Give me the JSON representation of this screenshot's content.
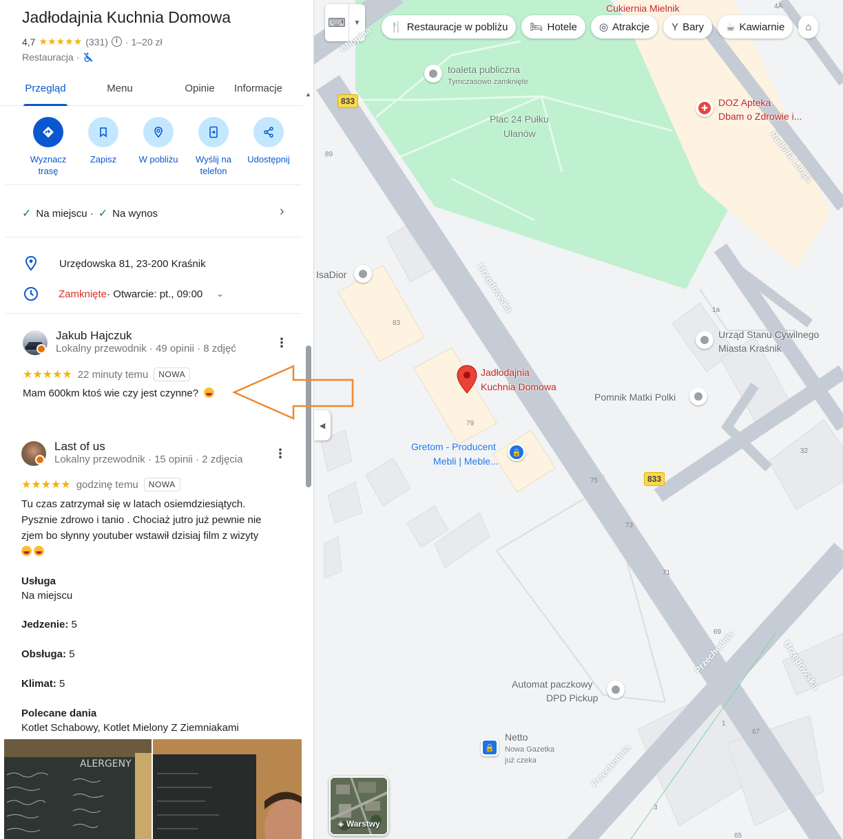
{
  "place": {
    "title": "Jadłodajnia Kuchnia Domowa",
    "rating": "4,7",
    "stars": "★★★★★",
    "review_count": "(331)",
    "price": "· 1–20 zł",
    "category": "Restauracja ·"
  },
  "tabs": [
    {
      "label": "Przegląd"
    },
    {
      "label": "Menu"
    },
    {
      "label": "Opinie"
    },
    {
      "label": "Informacje"
    }
  ],
  "actions": [
    {
      "label": "Wyznacz trasę",
      "icon": "directions-icon"
    },
    {
      "label": "Zapisz",
      "icon": "bookmark-icon"
    },
    {
      "label": "W pobliżu",
      "icon": "nearby-icon"
    },
    {
      "label": "Wyślij na telefon",
      "icon": "send-to-phone-icon"
    },
    {
      "label": "Udostępnij",
      "icon": "share-icon"
    }
  ],
  "service_options": {
    "dine_in": "Na miejscu ·",
    "takeaway": "Na wynos"
  },
  "address": "Urzędowska 81, 23-200 Kraśnik",
  "hours": {
    "status": "Zamknięte",
    "next": " · Otwarcie: pt., 09:00"
  },
  "reviews": [
    {
      "name": "Jakub Hajczuk",
      "meta": "Lokalny przewodnik · 49 opinii · 8 zdjęć",
      "stars": "★★★★★",
      "time": "22 minuty temu",
      "badge": "NOWA",
      "text": "Mam 600km ktoś wie czy jest czynne?"
    },
    {
      "name": "Last of us",
      "meta": "Lokalny przewodnik · 15 opinii · 2 zdjęcia",
      "stars": "★★★★★",
      "time": "godzinę temu",
      "badge": "NOWA",
      "text_lines": [
        "Tu czas zatrzymał się w latach osiemdziesiątych.",
        "Pysznie zdrowo i tanio . Chociaż jutro już pewnie nie",
        "zjem bo słynny youtuber wstawił dzisiaj  film z wizyty"
      ],
      "attributes": [
        {
          "label": "Usługa",
          "value": "Na miejscu"
        },
        {
          "label": "Jedzenie:",
          "value": "5"
        },
        {
          "label": "Obsługa:",
          "value": "5"
        },
        {
          "label": "Klimat:",
          "value": "5"
        },
        {
          "label": "Polecane dania",
          "value": "Kotlet Schabowy, Kotlet Mielony Z Ziemniakami"
        }
      ],
      "photo_text": "ALERGENY"
    }
  ],
  "map": {
    "chips": [
      {
        "label": "Restauracje w pobliżu",
        "icon": "fork-knife-icon"
      },
      {
        "label": "Hotele",
        "icon": "bed-icon"
      },
      {
        "label": "Atrakcje",
        "icon": "camera-icon"
      },
      {
        "label": "Bary",
        "icon": "cocktail-icon"
      },
      {
        "label": "Kawiarnie",
        "icon": "coffee-icon"
      }
    ],
    "labels": {
      "cukiernia": "Cukiernia Mielnik",
      "toaleta": "toaleta publiczna",
      "toaleta_sub": "Tymczasowo zamknięte",
      "plac_1": "Plac 24 Pułku",
      "plac_2": "Ułanów",
      "doz_1": "DOZ Apteka",
      "doz_2": "Dbam o Zdrowie i...",
      "isadior": "IsaDior",
      "urzad_1": "Urząd Stanu Cywilnego",
      "urzad_2": "Miasta Kraśnik",
      "place_1": "Jadłodajnia",
      "place_2": "Kuchnia Domowa",
      "pomnik": "Pomnik Matki Polki",
      "gretom_1": "Gretom - Producent",
      "gretom_2": "Mebli | Meble...",
      "dpd_1": "Automat paczkowy",
      "dpd_2": "DPD Pickup",
      "netto": "Netto",
      "netto_sub_1": "Nowa Gazetka",
      "netto_sub_2": "już czeka",
      "layers": "Warstwy"
    },
    "roads": {
      "chopina": "Chopina",
      "urzedowska": "Urzędowska",
      "urzedowska2": "Urzędowska",
      "rudolfa": "Rudolfa Langa",
      "przechodnia": "Przechodnia",
      "przechodnia2": "Przechodnia",
      "route": "833"
    },
    "numbers": {
      "n4a": "4A",
      "n89": "89",
      "n83": "83",
      "n79": "79",
      "n1a": "1a",
      "n75": "75",
      "n73": "73",
      "n71": "71",
      "n69": "69",
      "n32": "32",
      "n67": "67",
      "n1": "1",
      "n3": "3",
      "n65": "65"
    }
  },
  "colors": {
    "accent": "#0b57d0",
    "star": "#f5b400",
    "closed": "#d93025",
    "annotation_arrow": "#f0882e"
  }
}
